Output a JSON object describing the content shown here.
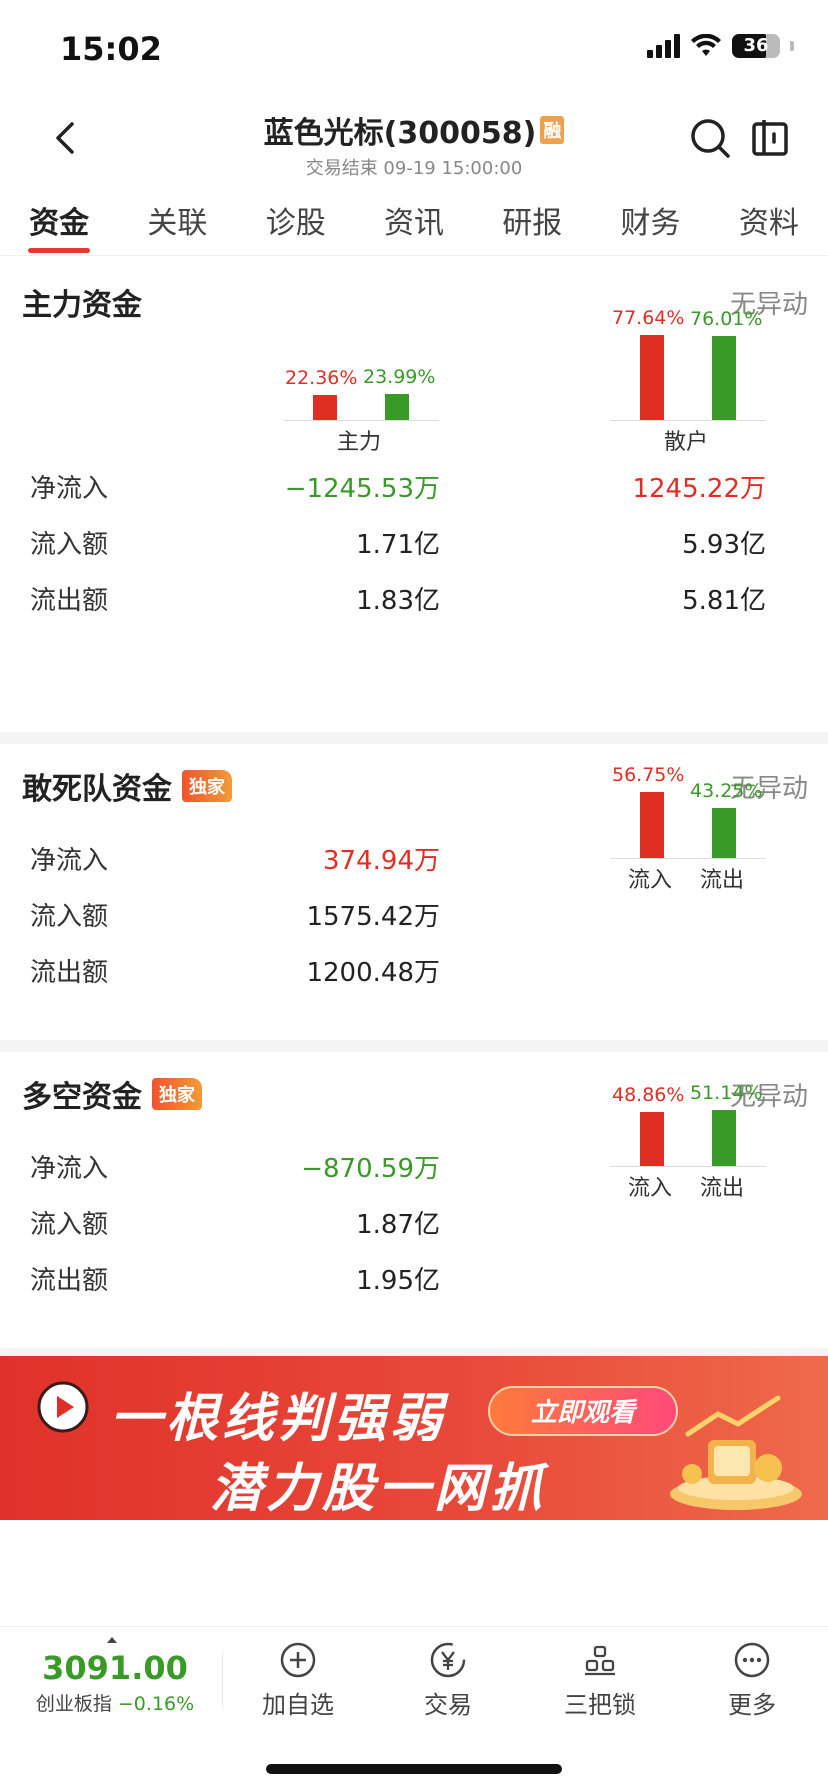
{
  "status_bar": {
    "time": "15:02",
    "battery": "36"
  },
  "header": {
    "title": "蓝色光标(300058)",
    "badge": "融",
    "subtitle": "交易结束 09-19 15:00:00"
  },
  "tabs": [
    "资金",
    "关联",
    "诊股",
    "资讯",
    "研报",
    "财务",
    "资料"
  ],
  "main_capital": {
    "title": "主力资金",
    "status": "无异动",
    "groups": [
      {
        "name": "主力",
        "in_pct": "22.36%",
        "out_pct": "23.99%",
        "in_value": 22.36,
        "out_value": 23.99
      },
      {
        "name": "散户",
        "in_pct": "77.64%",
        "out_pct": "76.01%",
        "in_value": 77.64,
        "out_value": 76.01
      }
    ],
    "rows": [
      {
        "label": "净流入",
        "main": "−1245.53万",
        "retail": "1245.22万"
      },
      {
        "label": "流入额",
        "main": "1.71亿",
        "retail": "5.93亿"
      },
      {
        "label": "流出额",
        "main": "1.83亿",
        "retail": "5.81亿"
      }
    ]
  },
  "dare_capital": {
    "title": "敢死队资金",
    "badge": "独家",
    "status": "无异动",
    "rows": [
      {
        "label": "净流入",
        "value": "374.94万"
      },
      {
        "label": "流入额",
        "value": "1575.42万"
      },
      {
        "label": "流出额",
        "value": "1200.48万"
      }
    ],
    "chart": {
      "in_label": "流入",
      "out_label": "流出",
      "in_pct": "56.75%",
      "out_pct": "43.25%",
      "in_value": 56.75,
      "out_value": 43.25
    }
  },
  "long_short_capital": {
    "title": "多空资金",
    "badge": "独家",
    "status": "无异动",
    "rows": [
      {
        "label": "净流入",
        "value": "−870.59万"
      },
      {
        "label": "流入额",
        "value": "1.87亿"
      },
      {
        "label": "流出额",
        "value": "1.95亿"
      }
    ],
    "chart": {
      "in_label": "流入",
      "out_label": "流出",
      "in_pct": "48.86%",
      "out_pct": "51.14%",
      "in_value": 48.86,
      "out_value": 51.14
    }
  },
  "banner": {
    "line1": "一根线判强弱",
    "line2": "潜力股一网抓",
    "cta": "立即观看"
  },
  "bottom_bar": {
    "index_value": "3091.00",
    "index_name": "创业板指",
    "index_change": "−0.16%",
    "items": [
      "加自选",
      "交易",
      "三把锁",
      "更多"
    ]
  },
  "colors": {
    "red": "#e02e24",
    "green": "#3a9a28",
    "accent": "#e63a2e"
  }
}
